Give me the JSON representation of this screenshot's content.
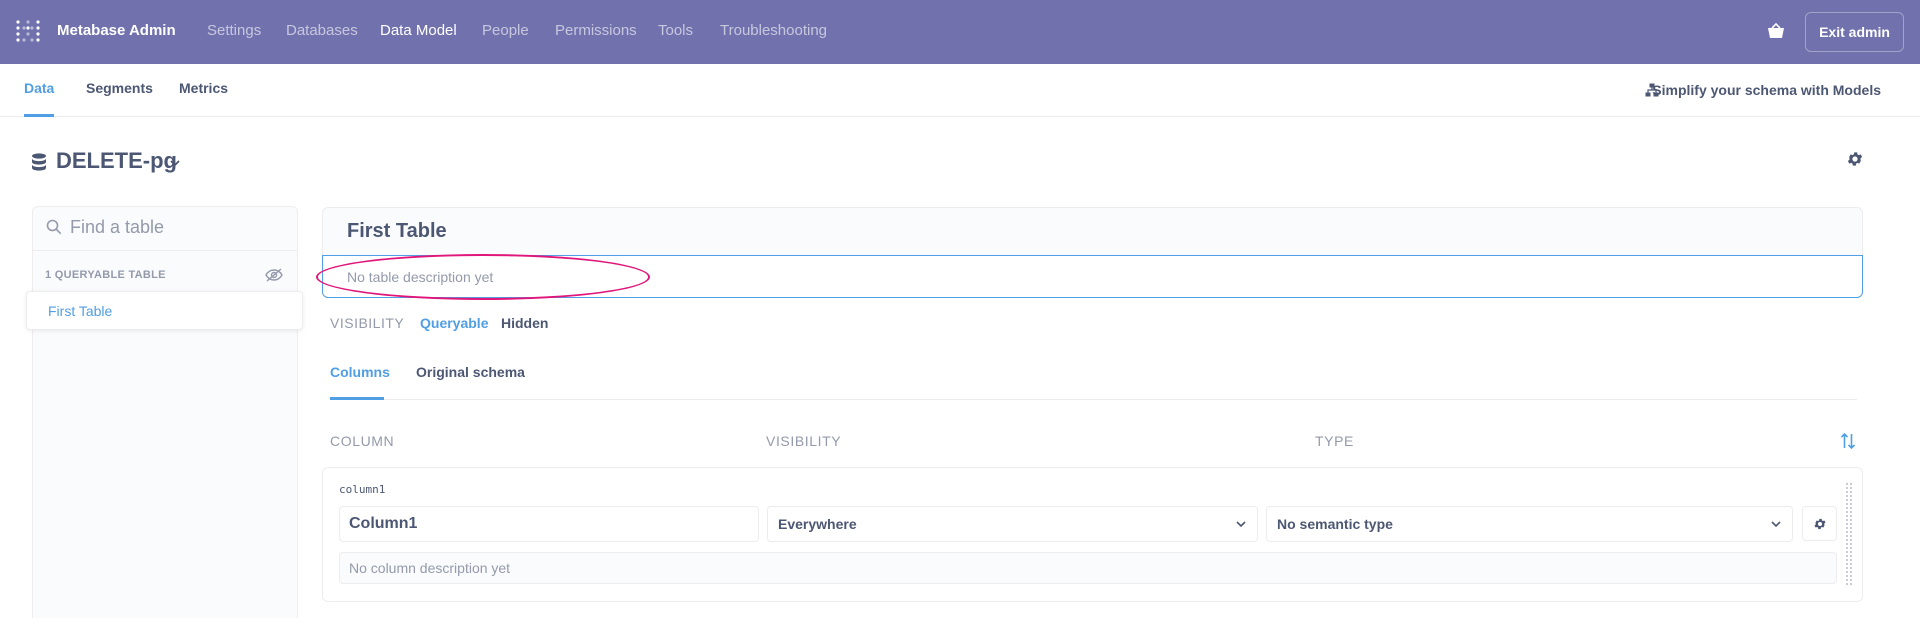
{
  "topbar": {
    "brand": "Metabase Admin",
    "nav": [
      "Settings",
      "Databases",
      "Data Model",
      "People",
      "Permissions",
      "Tools",
      "Troubleshooting"
    ],
    "active_nav": "Data Model",
    "exit_label": "Exit admin",
    "bg_color": "#7172ad"
  },
  "subnav": {
    "tabs": [
      "Data",
      "Segments",
      "Metrics"
    ],
    "active_tab": "Data",
    "simplify_label": "Simplify your schema with Models"
  },
  "database": {
    "name": "DELETE-pg"
  },
  "sidebar": {
    "search_placeholder": "Find a table",
    "section_label": "1 QUERYABLE TABLE",
    "tables": [
      "First Table"
    ]
  },
  "table": {
    "title": "First Table",
    "description_placeholder": "No table description yet",
    "visibility_label": "VISIBILITY",
    "visibility_options": [
      "Queryable",
      "Hidden"
    ],
    "active_visibility": "Queryable",
    "tabs": [
      "Columns",
      "Original schema"
    ],
    "active_tab": "Columns",
    "column_headers": [
      "COLUMN",
      "VISIBILITY",
      "TYPE"
    ]
  },
  "columns": [
    {
      "raw_name": "column1",
      "display_name": "Column1",
      "visibility": "Everywhere",
      "semantic_type": "No semantic type",
      "description_placeholder": "No column description yet"
    }
  ],
  "colors": {
    "accent": "#509ee3",
    "annotation": "#e0167b",
    "text": "#4c5773",
    "muted": "#949aab"
  }
}
